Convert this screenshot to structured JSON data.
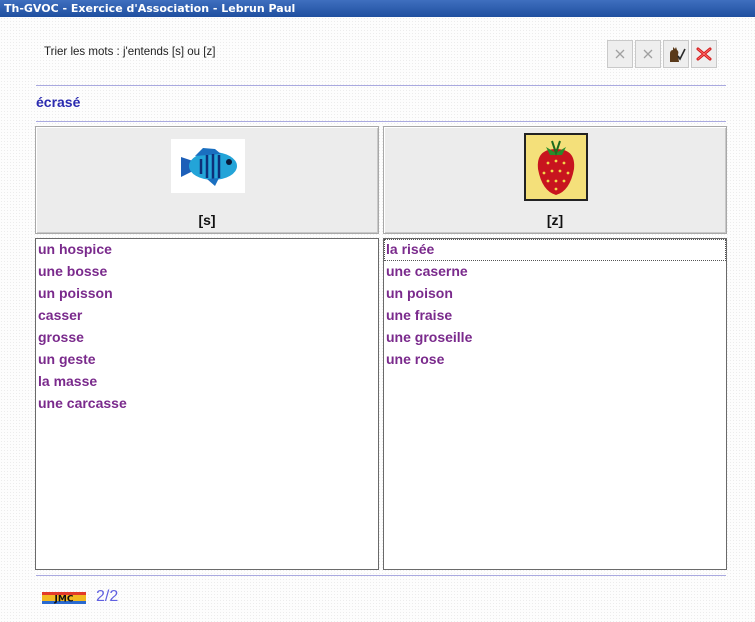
{
  "window": {
    "title": "Th-GVOC - Exercice d'Association - Lebrun Paul"
  },
  "instruction": "Trier les mots : j'entends [s] ou [z]",
  "toolbar": {
    "buttons": [
      {
        "icon": "close-gray-icon"
      },
      {
        "icon": "close-gray-icon"
      },
      {
        "icon": "cat-check-icon"
      },
      {
        "icon": "close-red-icon"
      }
    ]
  },
  "current_word": "écrasé",
  "columns": [
    {
      "label": "[s]",
      "icon": "fish-icon",
      "words": [
        "un hospice",
        "une bosse",
        "un poisson",
        "casser",
        "grosse",
        "un geste",
        "la masse",
        "une carcasse"
      ]
    },
    {
      "label": "[z]",
      "icon": "strawberry-icon",
      "words": [
        "la risée",
        "une caserne",
        "un poison",
        "une fraise",
        "une groseille",
        "une rose"
      ]
    }
  ],
  "footer": {
    "logo_text": "JMC",
    "progress": "2/2"
  },
  "colors": {
    "title_bar": "#1f4f9f",
    "word": "#2b2bb0",
    "list_text": "#7a2a8c",
    "progress": "#6060e0"
  }
}
